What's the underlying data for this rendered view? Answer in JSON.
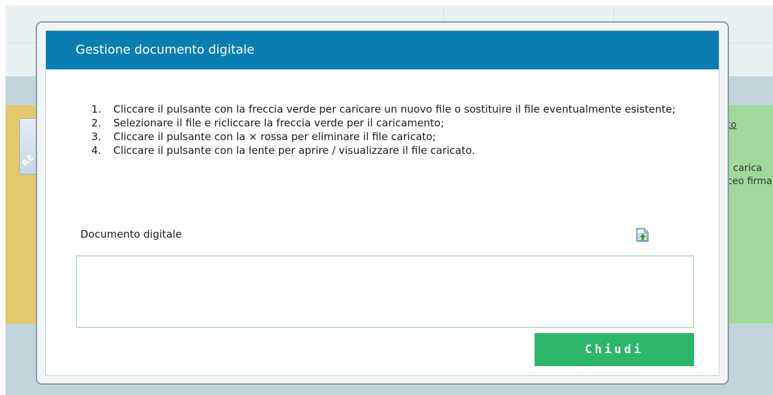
{
  "background": {
    "tab_label": "RE",
    "right_link": "to",
    "right_text_1": ", carica",
    "right_text_2": "ceo firma"
  },
  "modal": {
    "title": "Gestione documento digitale",
    "instructions": [
      {
        "num": "1.",
        "text": "Cliccare il pulsante con la freccia verde per caricare un nuovo file o sostituire il file eventualmente esistente;"
      },
      {
        "num": "2.",
        "text": "Selezionare il file e ricliccare la freccia verde per il caricamento;"
      },
      {
        "num": "3.",
        "text": "Cliccare il pulsante con la × rossa per eliminare il file caricato;"
      },
      {
        "num": "4.",
        "text": "Cliccare il pulsante con la lente per aprire / visualizzare il file caricato."
      }
    ],
    "document_label": "Documento digitale",
    "upload_icon": "upload-file-icon",
    "close_label": "Chiudi"
  },
  "colors": {
    "header": "#0b7db1",
    "button": "#2db56a",
    "upload_arrow": "#2aa52a"
  }
}
